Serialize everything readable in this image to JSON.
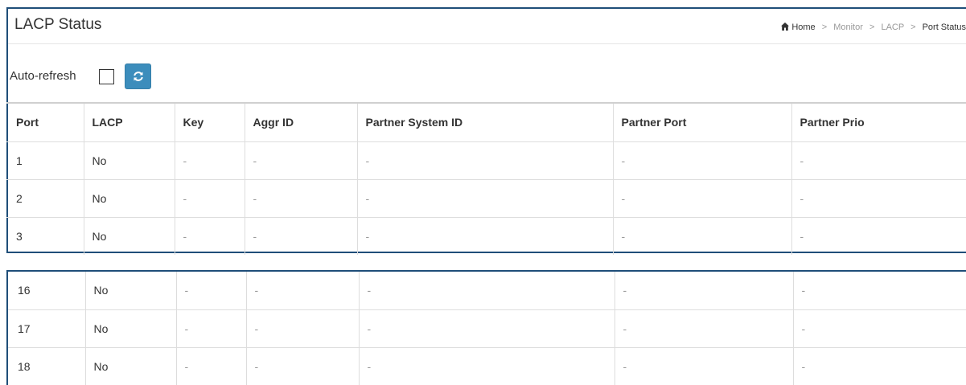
{
  "page": {
    "title": "LACP Status"
  },
  "breadcrumb": {
    "home": "Home",
    "items": [
      "Monitor",
      "LACP"
    ],
    "current": "Port Status",
    "separator": ">"
  },
  "toolbar": {
    "auto_refresh_label": "Auto-refresh",
    "auto_refresh_checked": false
  },
  "colors": {
    "accent": "#3c8dbc",
    "frame": "#1f4e79"
  },
  "table": {
    "columns": [
      "Port",
      "LACP",
      "Key",
      "Aggr ID",
      "Partner System ID",
      "Partner Port",
      "Partner Prio"
    ],
    "rows_top": [
      [
        "1",
        "No",
        "-",
        "-",
        "-",
        "-",
        "-"
      ],
      [
        "2",
        "No",
        "-",
        "-",
        "-",
        "-",
        "-"
      ],
      [
        "3",
        "No",
        "-",
        "-",
        "-",
        "-",
        "-"
      ]
    ],
    "rows_bottom": [
      [
        "16",
        "No",
        "-",
        "-",
        "-",
        "-",
        "-"
      ],
      [
        "17",
        "No",
        "-",
        "-",
        "-",
        "-",
        "-"
      ],
      [
        "18",
        "No",
        "-",
        "-",
        "-",
        "-",
        "-"
      ]
    ]
  }
}
